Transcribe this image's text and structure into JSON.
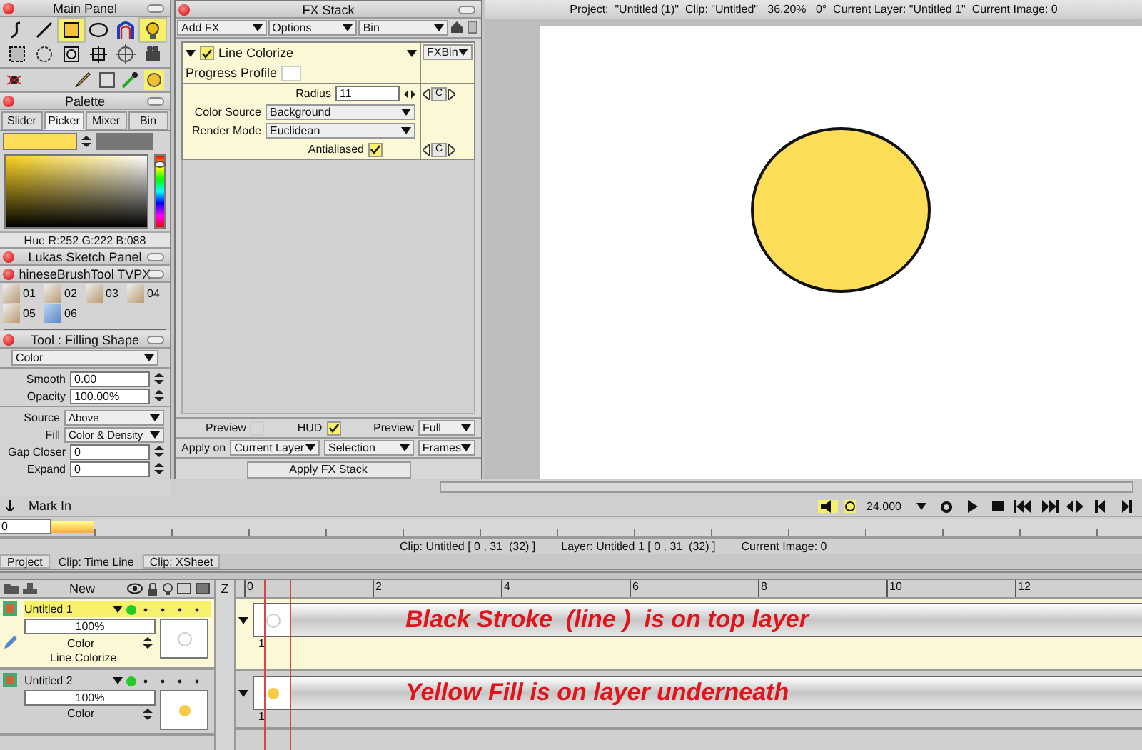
{
  "main_panel": {
    "title": "Main Panel",
    "tools": [
      {
        "kind": "curve",
        "selected": false
      },
      {
        "kind": "line",
        "selected": false
      },
      {
        "kind": "rectangle",
        "selected": true
      },
      {
        "kind": "ellipse",
        "selected": false
      },
      {
        "kind": "arch",
        "selected": false
      },
      {
        "kind": "bulb",
        "selected": true
      },
      {
        "kind": "marquee",
        "selected": false
      },
      {
        "kind": "lasso",
        "selected": false
      },
      {
        "kind": "zoom",
        "selected": false
      },
      {
        "kind": "crop",
        "selected": false
      },
      {
        "kind": "target",
        "selected": false
      },
      {
        "kind": "camera",
        "selected": false
      }
    ]
  },
  "palette": {
    "title": "Palette",
    "tabs": [
      {
        "label": "Slider",
        "selected": false
      },
      {
        "label": "Picker",
        "selected": true
      },
      {
        "label": "Mixer",
        "selected": false
      },
      {
        "label": "Bin",
        "selected": false
      }
    ],
    "color": "#fcde58",
    "hue_slider": {
      "level": 0.88
    },
    "readout": "Hue R:252 G:222 B:088"
  },
  "sketch_panel": {
    "title": "Lukas Sketch Panel"
  },
  "brush_panel": {
    "title": "hineseBrushTool TVPX",
    "brushes": [
      {
        "label": "01",
        "selected": false
      },
      {
        "label": "02",
        "selected": false
      },
      {
        "label": "03",
        "selected": false
      },
      {
        "label": "04",
        "selected": false
      },
      {
        "label": "05",
        "selected": false
      },
      {
        "label": "06",
        "selected": true
      }
    ]
  },
  "tool_panel": {
    "title": "Tool : Filling Shape",
    "mode": "Color",
    "fields": [
      {
        "label": "Smooth",
        "value": "0.00"
      },
      {
        "label": "Opacity",
        "value": "100.00%"
      }
    ],
    "options": [
      {
        "kind": "select",
        "label": "Source",
        "value": "Above"
      },
      {
        "kind": "select",
        "label": "Fill",
        "value": "Color & Density"
      },
      {
        "kind": "input",
        "label": "Gap Closer",
        "value": "0"
      },
      {
        "kind": "input",
        "label": "Expand",
        "value": "0"
      }
    ]
  },
  "fx_stack": {
    "title": "FX Stack",
    "menus": [
      "Add FX",
      "Options",
      "Bin"
    ],
    "effect": {
      "name": "Line Colorize",
      "enabled": true,
      "bin": "FXBin",
      "progress_label": "Progress Profile",
      "params": [
        {
          "kind": "number",
          "label": "Radius",
          "value": "11",
          "key": "C"
        },
        {
          "kind": "select",
          "label": "Color Source",
          "value": "Background"
        },
        {
          "kind": "select",
          "label": "Render Mode",
          "value": "Euclidean"
        },
        {
          "kind": "checkbox",
          "label": "Antialiased",
          "checked": true,
          "key": "C"
        }
      ]
    },
    "preview": {
      "label": "Preview",
      "checked": false
    },
    "hud": {
      "label": "HUD",
      "checked": true
    },
    "preview_mode": {
      "label": "Preview",
      "value": "Full"
    },
    "apply_on": {
      "label": "Apply on",
      "options": [
        "Current Layer",
        "Selection",
        "Frames"
      ]
    },
    "apply_button": "Apply FX Stack"
  },
  "canvas": {
    "info": "Project:  \"Untitled (1)\"  Clip: \"Untitled\"   36.20%   0°  Current Layer: \"Untitled 1\"  Current Image: 0"
  },
  "transport": {
    "mark_in": "Mark In",
    "frame": "0",
    "fps": "24.000"
  },
  "status_bar": {
    "clip": "Clip: Untitled [ 0 , 31  (32) ]",
    "layer": "Layer: Untitled 1 [ 0 , 31  (32) ]",
    "image": "Current Image: 0"
  },
  "bottom_tabs": [
    {
      "label": "Project",
      "selected": false
    },
    {
      "label": "Clip: Time Line",
      "selected": true
    },
    {
      "label": "Clip: XSheet",
      "selected": false
    }
  ],
  "timeline": {
    "new_label": "New",
    "z_label": "Z",
    "ruler": [
      "0",
      "2",
      "4",
      "6",
      "8",
      "10",
      "12"
    ],
    "layers": [
      {
        "name": "Untitled 1",
        "selected": true,
        "opacity": "100%",
        "blend": "Color",
        "fx": "Line Colorize",
        "kind": "stroke",
        "frame": "1",
        "annotation": "Black Stroke  (line )  is on top layer"
      },
      {
        "name": "Untitled 2",
        "selected": false,
        "opacity": "100%",
        "blend": "Color",
        "kind": "fill",
        "frame": "1",
        "annotation": "Yellow Fill is on layer underneath"
      }
    ]
  }
}
